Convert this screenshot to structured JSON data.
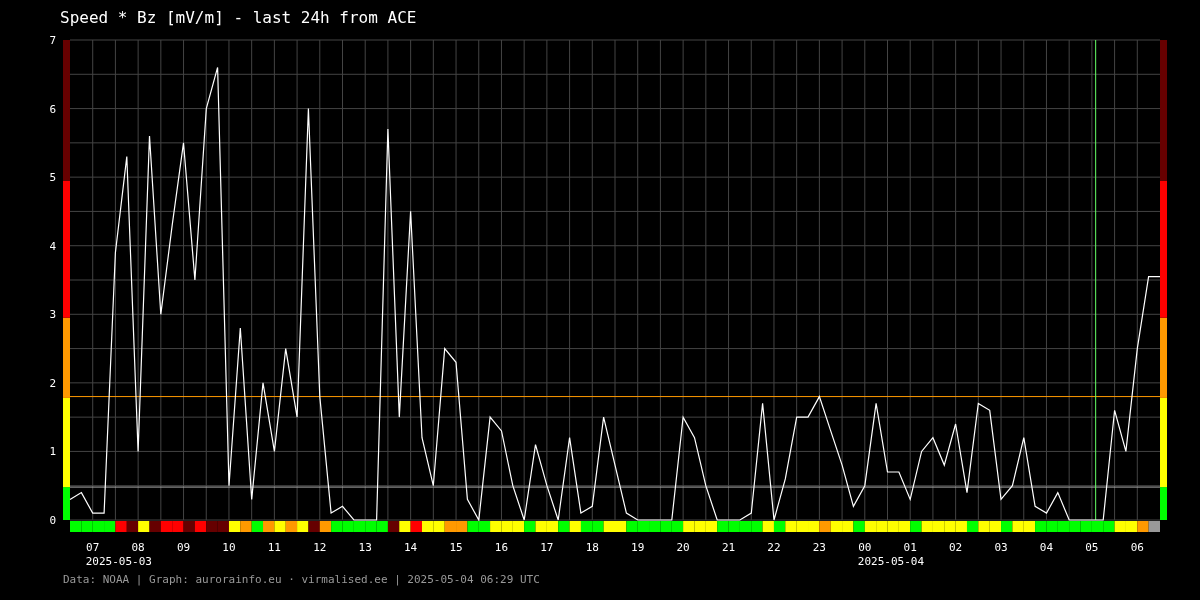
{
  "title": "Speed * Bz [mV/m] - last 24h from ACE",
  "chart": {
    "chart_data": {
      "type": "line",
      "x": [
        "2025-05-03T06:30",
        "2025-05-03T06:45",
        "2025-05-03T07:00",
        "2025-05-03T07:15",
        "2025-05-03T07:30",
        "2025-05-03T07:45",
        "2025-05-03T08:00",
        "2025-05-03T08:15",
        "2025-05-03T08:30",
        "2025-05-03T08:45",
        "2025-05-03T09:00",
        "2025-05-03T09:15",
        "2025-05-03T09:30",
        "2025-05-03T09:45",
        "2025-05-03T10:00",
        "2025-05-03T10:15",
        "2025-05-03T10:30",
        "2025-05-03T10:45",
        "2025-05-03T11:00",
        "2025-05-03T11:15",
        "2025-05-03T11:30",
        "2025-05-03T11:45",
        "2025-05-03T12:00",
        "2025-05-03T12:15",
        "2025-05-03T12:30",
        "2025-05-03T12:45",
        "2025-05-03T13:00",
        "2025-05-03T13:15",
        "2025-05-03T13:30",
        "2025-05-03T13:45",
        "2025-05-03T14:00",
        "2025-05-03T14:15",
        "2025-05-03T14:30",
        "2025-05-03T14:45",
        "2025-05-03T15:00",
        "2025-05-03T15:15",
        "2025-05-03T15:30",
        "2025-05-03T15:45",
        "2025-05-03T16:00",
        "2025-05-03T16:15",
        "2025-05-03T16:30",
        "2025-05-03T16:45",
        "2025-05-03T17:00",
        "2025-05-03T17:15",
        "2025-05-03T17:30",
        "2025-05-03T17:45",
        "2025-05-03T18:00",
        "2025-05-03T18:15",
        "2025-05-03T18:30",
        "2025-05-03T18:45",
        "2025-05-03T19:00",
        "2025-05-03T19:15",
        "2025-05-03T19:30",
        "2025-05-03T19:45",
        "2025-05-03T20:00",
        "2025-05-03T20:15",
        "2025-05-03T20:30",
        "2025-05-03T20:45",
        "2025-05-03T21:00",
        "2025-05-03T21:15",
        "2025-05-03T21:30",
        "2025-05-03T21:45",
        "2025-05-03T22:00",
        "2025-05-03T22:15",
        "2025-05-03T22:30",
        "2025-05-03T22:45",
        "2025-05-03T23:00",
        "2025-05-03T23:15",
        "2025-05-03T23:30",
        "2025-05-03T23:45",
        "2025-05-04T00:00",
        "2025-05-04T00:15",
        "2025-05-04T00:30",
        "2025-05-04T00:45",
        "2025-05-04T01:00",
        "2025-05-04T01:15",
        "2025-05-04T01:30",
        "2025-05-04T01:45",
        "2025-05-04T02:00",
        "2025-05-04T02:15",
        "2025-05-04T02:30",
        "2025-05-04T02:45",
        "2025-05-04T03:00",
        "2025-05-04T03:15",
        "2025-05-04T03:30",
        "2025-05-04T03:45",
        "2025-05-04T04:00",
        "2025-05-04T04:15",
        "2025-05-04T04:30",
        "2025-05-04T04:45",
        "2025-05-04T05:00",
        "2025-05-04T05:15",
        "2025-05-04T05:30",
        "2025-05-04T05:45",
        "2025-05-04T06:00",
        "2025-05-04T06:15",
        "2025-05-04T06:30"
      ],
      "series": [
        {
          "color": "#ffffff",
          "values": [
            0.3,
            0.4,
            0.1,
            0.1,
            3.9,
            5.3,
            1.0,
            5.6,
            3.0,
            4.3,
            5.5,
            3.5,
            6.0,
            6.6,
            0.5,
            2.8,
            0.3,
            2.0,
            1.0,
            2.5,
            1.5,
            6.0,
            1.8,
            0.1,
            0.2,
            0,
            0,
            0,
            5.7,
            1.5,
            4.5,
            1.2,
            0.5,
            2.5,
            2.3,
            0.3,
            0,
            1.5,
            1.3,
            0.5,
            0,
            1.1,
            0.5,
            0,
            1.2,
            0.1,
            0.2,
            1.5,
            0.8,
            0.1,
            0,
            0,
            0,
            0,
            1.5,
            1.2,
            0.5,
            0,
            0,
            0,
            0.1,
            1.7,
            0,
            0.6,
            1.5,
            1.5,
            1.8,
            1.3,
            0.8,
            0.2,
            0.5,
            1.7,
            0.7,
            0.7,
            0.3,
            1.0,
            1.2,
            0.8,
            1.4,
            0.4,
            1.7,
            1.6,
            0.3,
            0.5,
            1.2,
            0.2,
            0.1,
            0.4,
            0,
            0,
            0,
            0,
            1.6,
            1.0,
            2.5,
            3.55,
            3.55
          ]
        }
      ],
      "xlim": [
        "2025-05-03T06:30",
        "2025-05-04T06:30"
      ],
      "ylim": [
        0,
        7
      ],
      "xticks": [
        {
          "value": "2025-05-03T07:00",
          "label": "07"
        },
        {
          "value": "2025-05-03T08:00",
          "label": "08"
        },
        {
          "value": "2025-05-03T09:00",
          "label": "09"
        },
        {
          "value": "2025-05-03T10:00",
          "label": "10"
        },
        {
          "value": "2025-05-03T11:00",
          "label": "11"
        },
        {
          "value": "2025-05-03T12:00",
          "label": "12"
        },
        {
          "value": "2025-05-03T13:00",
          "label": "13"
        },
        {
          "value": "2025-05-03T14:00",
          "label": "14"
        },
        {
          "value": "2025-05-03T15:00",
          "label": "15"
        },
        {
          "value": "2025-05-03T16:00",
          "label": "16"
        },
        {
          "value": "2025-05-03T17:00",
          "label": "17"
        },
        {
          "value": "2025-05-03T18:00",
          "label": "18"
        },
        {
          "value": "2025-05-03T19:00",
          "label": "19"
        },
        {
          "value": "2025-05-03T20:00",
          "label": "20"
        },
        {
          "value": "2025-05-03T21:00",
          "label": "21"
        },
        {
          "value": "2025-05-03T22:00",
          "label": "22"
        },
        {
          "value": "2025-05-03T23:00",
          "label": "23"
        },
        {
          "value": "2025-05-04T00:00",
          "label": "00"
        },
        {
          "value": "2025-05-04T01:00",
          "label": "01"
        },
        {
          "value": "2025-05-04T02:00",
          "label": "02"
        },
        {
          "value": "2025-05-04T03:00",
          "label": "03"
        },
        {
          "value": "2025-05-04T04:00",
          "label": "04"
        },
        {
          "value": "2025-05-04T05:00",
          "label": "05"
        },
        {
          "value": "2025-05-04T06:00",
          "label": "06"
        }
      ],
      "yticks": [
        0,
        1,
        2,
        3,
        4,
        5,
        6,
        7
      ],
      "grid": true,
      "ref_lines": [
        {
          "axis": "y",
          "value": 1.8,
          "color": "#ff9900"
        },
        {
          "axis": "y",
          "value": 0.48,
          "color": "#aaaaaa"
        },
        {
          "axis": "x",
          "value": "2025-05-04T05:05",
          "color": "#66ff66"
        }
      ],
      "annotations": [
        "2025-05-03",
        "2025-05-04"
      ]
    }
  },
  "footer": "Data: NOAA | Graph: aurorainfo.eu · virmalised.ee | 2025-05-04 06:29 UTC"
}
